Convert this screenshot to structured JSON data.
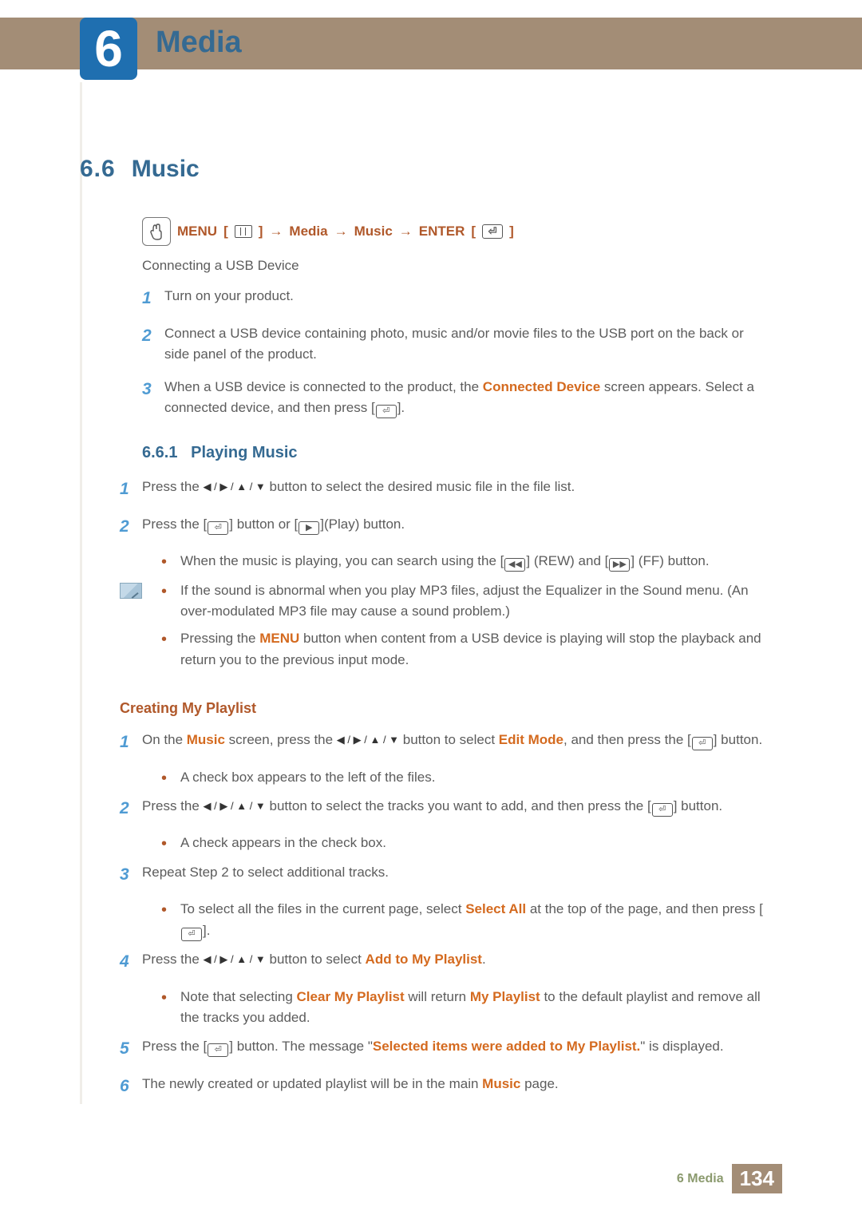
{
  "chapter": {
    "number": "6",
    "title": "Media"
  },
  "section": {
    "number": "6.6",
    "title": "Music"
  },
  "navpath": {
    "menu": "MENU",
    "media": "Media",
    "music": "Music",
    "enter": "ENTER"
  },
  "intro": {
    "heading": "Connecting a USB Device",
    "step1": "Turn on your product.",
    "step2": "Connect a USB device containing photo, music and/or movie files to the USB port on the back or side panel of the product.",
    "step3_a": "When a USB device is connected to the product, the ",
    "step3_hl": "Connected Device",
    "step3_b": " screen appears. Select a connected device, and then press [",
    "step3_c": "]."
  },
  "sub1": {
    "num": "6.6.1",
    "title": "Playing Music",
    "s1_a": "Press the ",
    "s1_b": " button to select the desired music file in the file list.",
    "s2_a": "Press the [",
    "s2_b": "] button or [",
    "s2_c": "](Play) button.",
    "s2_bul_a": "When the music is playing, you can search using the [",
    "s2_bul_b": "] (REW) and [",
    "s2_bul_c": "] (FF) button.",
    "note1": "If the sound is abnormal when you play MP3 files, adjust the Equalizer in the Sound menu. (An over-modulated MP3 file may cause a sound problem.)",
    "note2_a": "Pressing the ",
    "note2_hl": "MENU",
    "note2_b": " button when content from a USB device is playing will stop the playback and return you to the previous input mode."
  },
  "sub2": {
    "title": "Creating My Playlist",
    "s1_a": "On the ",
    "s1_hl1": "Music",
    "s1_b": " screen, press the ",
    "s1_c": " button to select ",
    "s1_hl2": "Edit Mode",
    "s1_d": ", and then press the [",
    "s1_e": "] button.",
    "s1_bul": "A check box appears to the left of the files.",
    "s2_a": "Press the ",
    "s2_b": " button to select the tracks you want to add, and then press the [",
    "s2_c": "] button.",
    "s2_bul": "A check appears in the check box.",
    "s3": "Repeat Step 2 to select additional tracks.",
    "s3_bul_a": "To select all the files in the current page, select ",
    "s3_hl": "Select All",
    "s3_bul_b": " at the top of the page, and then press [",
    "s3_bul_c": "].",
    "s4_a": "Press the ",
    "s4_b": " button to select ",
    "s4_hl": "Add to My Playlist",
    "s4_c": ".",
    "s4_bul_a": "Note that selecting ",
    "s4_hl2": "Clear My Playlist",
    "s4_bul_b": " will return ",
    "s4_hl3": "My Playlist",
    "s4_bul_c": " to the default playlist and remove all the tracks you added.",
    "s5_a": "Press the [",
    "s5_b": "] button. The message \"",
    "s5_hl": "Selected items were added to My Playlist.",
    "s5_c": "\" is displayed.",
    "s6_a": "The newly created or updated playlist will be in the main ",
    "s6_hl": "Music",
    "s6_b": " page."
  },
  "footer": {
    "label": "6 Media",
    "page": "134"
  },
  "nums": {
    "n1": "1",
    "n2": "2",
    "n3": "3",
    "n4": "4",
    "n5": "5",
    "n6": "6"
  }
}
